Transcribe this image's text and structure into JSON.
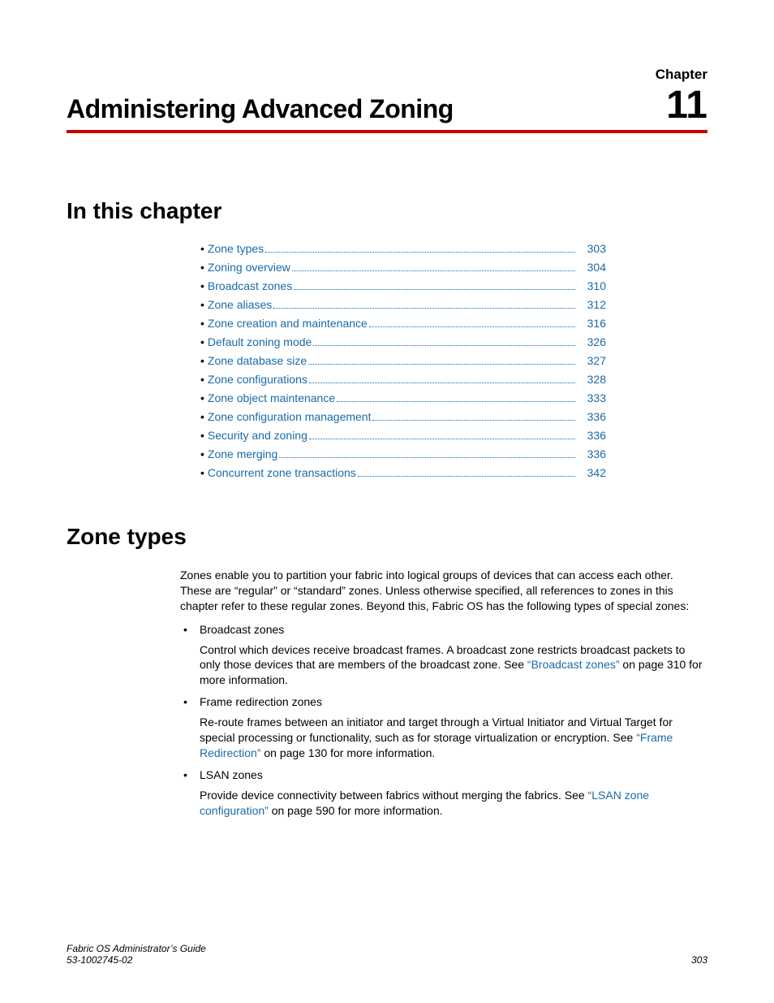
{
  "header": {
    "chapter_label": "Chapter",
    "title": "Administering Advanced Zoning",
    "number": "11"
  },
  "sections": {
    "in_this_chapter": "In this chapter",
    "zone_types": "Zone types"
  },
  "toc": [
    {
      "label": "Zone types",
      "page": "303"
    },
    {
      "label": "Zoning overview",
      "page": "304"
    },
    {
      "label": "Broadcast zones",
      "page": "310"
    },
    {
      "label": "Zone aliases",
      "page": "312"
    },
    {
      "label": "Zone creation and maintenance",
      "page": "316"
    },
    {
      "label": "Default zoning mode",
      "page": "326"
    },
    {
      "label": "Zone database size",
      "page": "327"
    },
    {
      "label": "Zone configurations",
      "page": "328"
    },
    {
      "label": "Zone object maintenance",
      "page": "333"
    },
    {
      "label": "Zone configuration management",
      "page": "336"
    },
    {
      "label": "Security and zoning",
      "page": "336"
    },
    {
      "label": "Zone merging",
      "page": "336"
    },
    {
      "label": "Concurrent zone transactions",
      "page": "342"
    }
  ],
  "zone_types_body": {
    "intro": "Zones enable you to partition your fabric into logical groups of devices that can access each other. These are “regular” or “standard” zones. Unless otherwise specified, all references to zones in this chapter refer to these regular zones. Beyond this, Fabric OS has the following types of special zones:",
    "items": [
      {
        "title": "Broadcast zones",
        "desc_pre": "Control which devices receive broadcast frames. A broadcast zone restricts broadcast packets to only those devices that are members of the broadcast zone. See ",
        "link": "“Broadcast zones”",
        "desc_post": " on page 310 for more information."
      },
      {
        "title": "Frame redirection zones",
        "desc_pre": "Re-route frames between an initiator and target through a Virtual Initiator and Virtual Target for special processing or functionality, such as for storage virtualization or encryption. See ",
        "link": "“Frame Redirection”",
        "desc_post": " on page 130 for more information."
      },
      {
        "title": "LSAN zones",
        "desc_pre": "Provide device connectivity between fabrics without merging the fabrics. See ",
        "link": "“LSAN zone configuration”",
        "desc_post": " on page 590 for more information."
      }
    ]
  },
  "footer": {
    "left_line1": "Fabric OS Administrator’s Guide",
    "left_line2": "53-1002745-02",
    "right": "303"
  }
}
